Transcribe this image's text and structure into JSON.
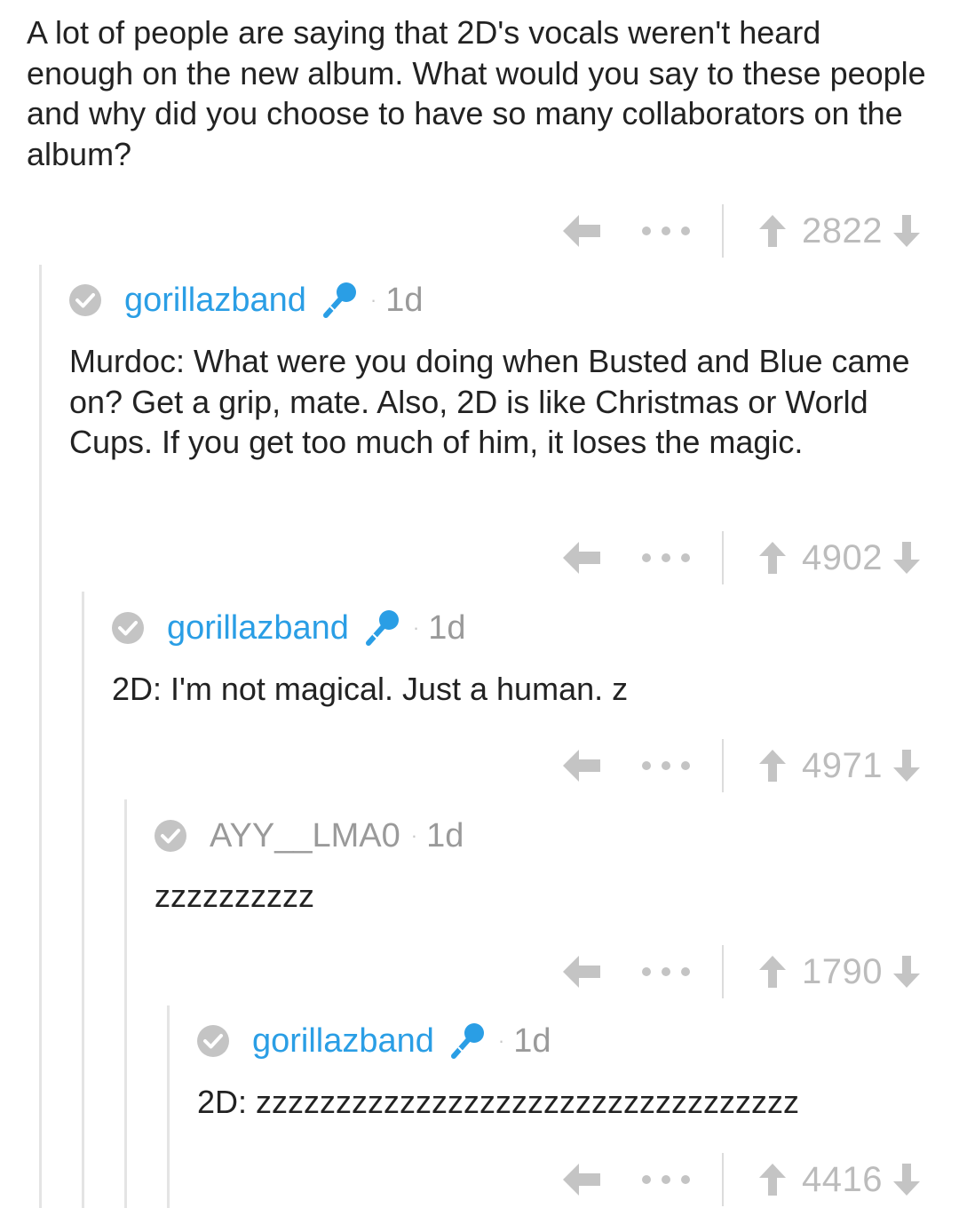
{
  "parent": {
    "text": "A lot of people are saying that 2D's vocals weren't heard enough on the new album. What would you say to these people and why did you choose to have so many collaborators on the album?",
    "score": "2822"
  },
  "comments": [
    {
      "username": "gorillazband",
      "flair": "microphone-icon",
      "age": "1d",
      "body": "Murdoc: What were you doing when Busted and Blue came on? Get a grip, mate. Also, 2D is like Christmas or World Cups. If you get too much of him, it loses the magic.",
      "score": "4902"
    },
    {
      "username": "gorillazband",
      "flair": "microphone-icon",
      "age": "1d",
      "body": "2D: I'm not magical. Just a human. z",
      "score": "4971"
    },
    {
      "username": "AYY__LMA0",
      "age": "1d",
      "body": "zzzzzzzzzz",
      "score": "1790"
    },
    {
      "username": "gorillazband",
      "flair": "microphone-icon",
      "age": "1d",
      "body": "2D: zzzzzzzzzzzzzzzzzzzzzzzzzzzzzzzzzz",
      "score": "4416"
    }
  ],
  "separator": "·",
  "icons": {
    "reply": "reply-arrow-icon",
    "more": "more-dots-icon",
    "upvote": "upvote-arrow-icon",
    "downvote": "downvote-arrow-icon",
    "verified": "verified-check-icon"
  },
  "colors": {
    "moderator_name": "#2a9ee5",
    "user_name": "#9a9a9a",
    "icon_gray": "#c4c4c4",
    "thread_line": "#e4e4e4",
    "text": "#222222"
  }
}
